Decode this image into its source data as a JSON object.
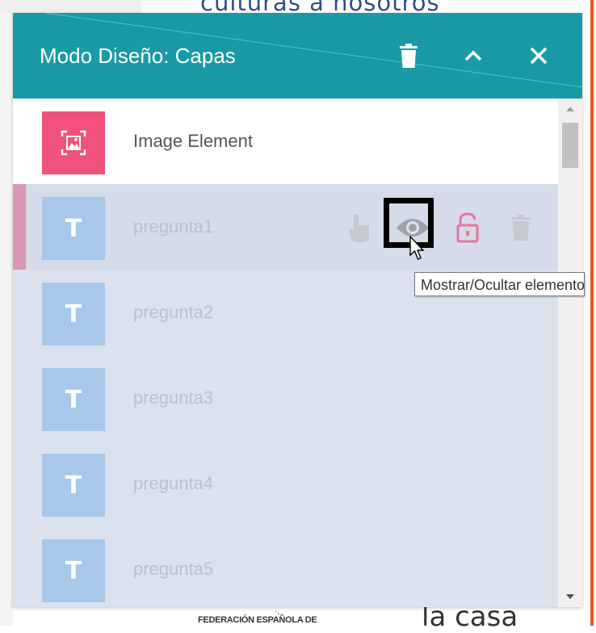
{
  "background": {
    "top_text": "culturas a nosotros",
    "bottom_org": "FEDERACIÓN ESPAÑOLA DE",
    "bottom_dots": "·,",
    "bottom_text": "la casa"
  },
  "panel": {
    "title": "Modo Diseño: Capas",
    "icons": {
      "trash": "trash-icon",
      "collapse": "chevron-up-icon",
      "close": "close-icon"
    }
  },
  "layers": [
    {
      "label": "Image Element",
      "type": "image",
      "selected": true
    },
    {
      "label": "pregunta1",
      "type": "text",
      "thumb_letter": "T",
      "hovered": true
    },
    {
      "label": "pregunta2",
      "type": "text",
      "thumb_letter": "T"
    },
    {
      "label": "pregunta3",
      "type": "text",
      "thumb_letter": "T"
    },
    {
      "label": "pregunta4",
      "type": "text",
      "thumb_letter": "T"
    },
    {
      "label": "pregunta5",
      "type": "text",
      "thumb_letter": "T"
    }
  ],
  "row_actions": {
    "move": "hand-pointer-icon",
    "visibility": "eye-icon",
    "lock": "unlock-icon",
    "delete": "trash-icon"
  },
  "tooltip": "Mostrar/Ocultar elemento",
  "colors": {
    "header": "#1a9aa4",
    "image_thumb": "#f0527c",
    "text_thumb": "#a8c8ea",
    "lock_icon": "#e8769c",
    "accent": "#d996b6"
  }
}
